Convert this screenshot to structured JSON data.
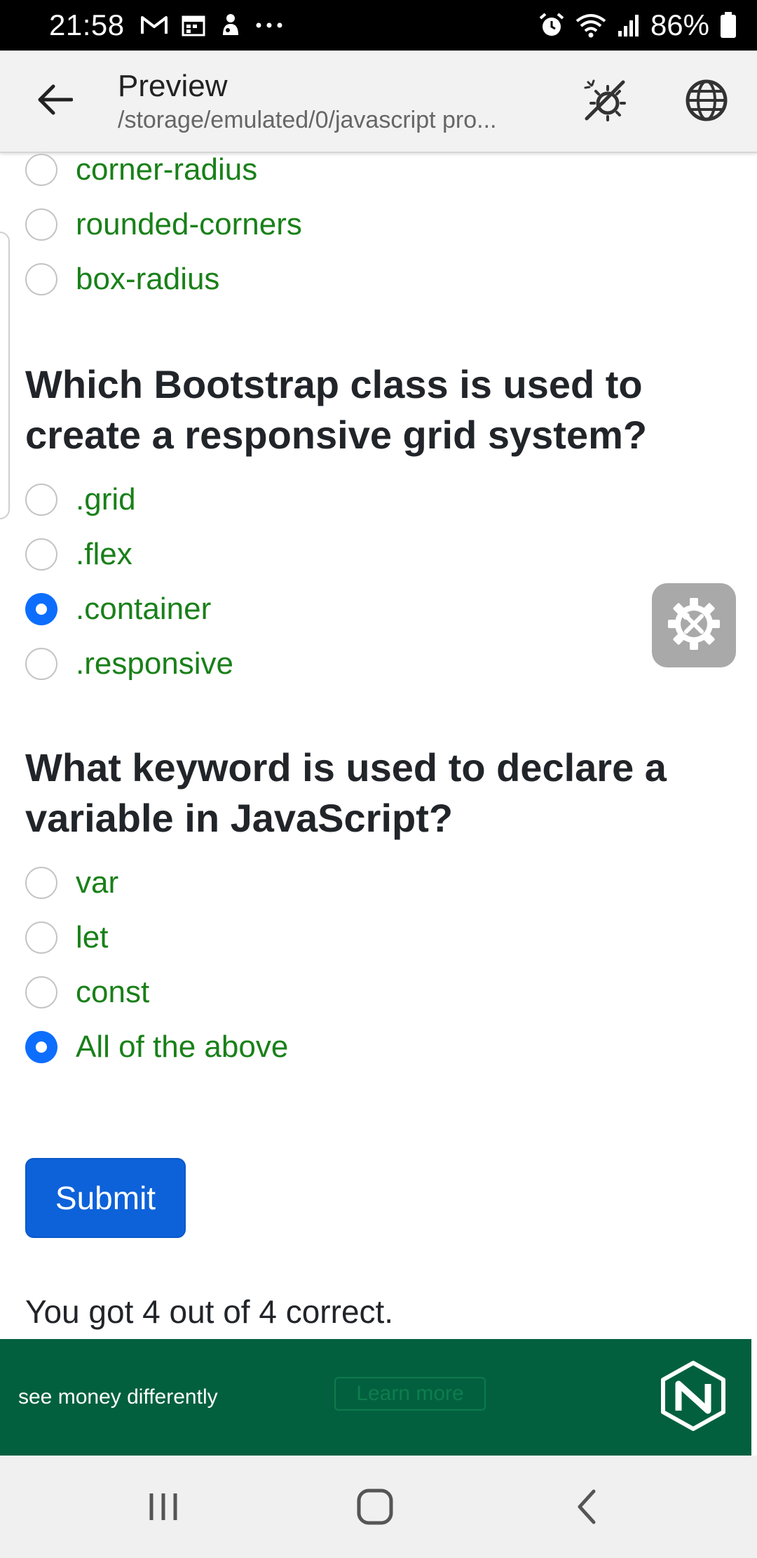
{
  "status_bar": {
    "time": "21:58",
    "left_icons": [
      "gmail-icon",
      "calendar-icon",
      "notification-icon",
      "more-icon"
    ],
    "right_icons": [
      "alarm-icon",
      "wifi-icon",
      "signal-icon",
      "battery-icon"
    ],
    "battery": "86%"
  },
  "app_bar": {
    "title": "Preview",
    "subtitle": "/storage/emulated/0/javascript pro..."
  },
  "quiz": {
    "prev_options": [
      {
        "label": "corner-radius",
        "checked": false
      },
      {
        "label": "rounded-corners",
        "checked": false
      },
      {
        "label": "box-radius",
        "checked": false
      }
    ],
    "q1": {
      "question": "Which Bootstrap class is used to create a responsive grid system?",
      "options": [
        {
          "label": ".grid",
          "checked": false
        },
        {
          "label": ".flex",
          "checked": false
        },
        {
          "label": ".container",
          "checked": true
        },
        {
          "label": ".responsive",
          "checked": false
        }
      ]
    },
    "q2": {
      "question": "What keyword is used to declare a variable in JavaScript?",
      "options": [
        {
          "label": "var",
          "checked": false
        },
        {
          "label": "let",
          "checked": false
        },
        {
          "label": "const",
          "checked": false
        },
        {
          "label": "All of the above",
          "checked": true
        }
      ]
    },
    "submit_label": "Submit",
    "result": "You got 4 out of 4 correct."
  },
  "ad": {
    "tagline": "see money differently",
    "button": "Learn more",
    "brand_color": "#02603f"
  },
  "colors": {
    "option_text": "#198019",
    "radio_checked": "#0d6efd",
    "submit_bg": "#0d62d9"
  }
}
